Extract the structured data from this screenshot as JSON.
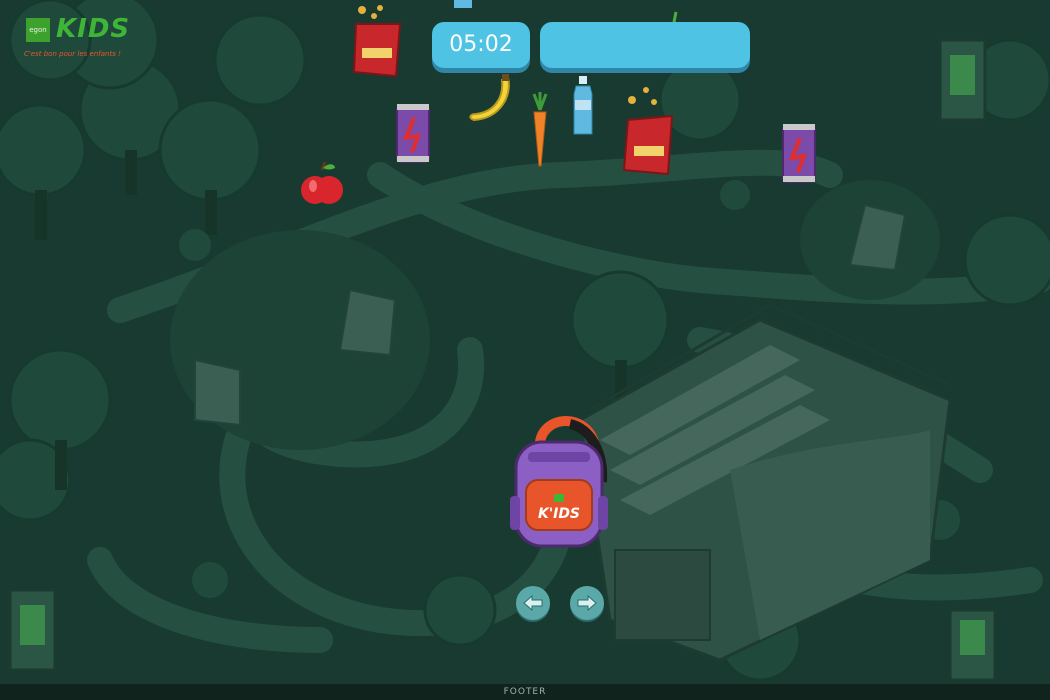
{
  "logo": {
    "box_text": "egon",
    "kids_text": "KIDS",
    "subtitle": "C'est bon pour les enfants !"
  },
  "hud": {
    "timer": "05:02",
    "progress": 0,
    "progress_color": "#7ed957",
    "panel_color": "#4fc3e3"
  },
  "items": [
    {
      "name": "water-bottle-item",
      "type": "bottle"
    },
    {
      "name": "chips-bag-item",
      "type": "chips"
    },
    {
      "name": "apple-item",
      "type": "apple"
    },
    {
      "name": "soda-can-item",
      "type": "can"
    },
    {
      "name": "banana-item",
      "type": "banana"
    },
    {
      "name": "carrot-item",
      "type": "carrot"
    },
    {
      "name": "water-bottle-item",
      "type": "bottle"
    },
    {
      "name": "chips-bag-item",
      "type": "chips"
    },
    {
      "name": "soda-can-item",
      "type": "can"
    },
    {
      "name": "apple-item",
      "type": "apple"
    }
  ],
  "player": {
    "name": "backpack",
    "label": "K'IDS"
  },
  "controls": {
    "left_icon": "arrow-left-icon",
    "right_icon": "arrow-right-icon"
  },
  "footer": {
    "text": "FOOTER"
  },
  "colors": {
    "background": "#183a30",
    "path": "#2b5a4a",
    "tree": "#1e4c3c",
    "ramp": "#3a5e52",
    "accent": "#e8552a"
  }
}
